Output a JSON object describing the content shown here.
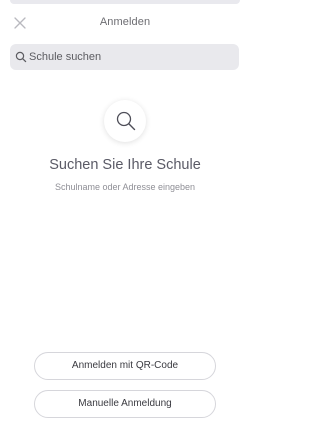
{
  "header": {
    "title": "Anmelden",
    "close_icon": "close-icon"
  },
  "search": {
    "placeholder": "Schule suchen",
    "icon": "search-icon"
  },
  "empty_state": {
    "icon": "search-icon",
    "title": "Suchen Sie Ihre Schule",
    "subtitle": "Schulname oder Adresse eingeben"
  },
  "actions": {
    "qr_login_label": "Anmelden mit QR-Code",
    "manual_login_label": "Manuelle Anmeldung"
  },
  "colors": {
    "background": "#ffffff",
    "search_background": "#e9e9ed",
    "title_text": "#5a5a66",
    "muted_text": "#8f8f96",
    "button_border": "#d6d6db"
  }
}
